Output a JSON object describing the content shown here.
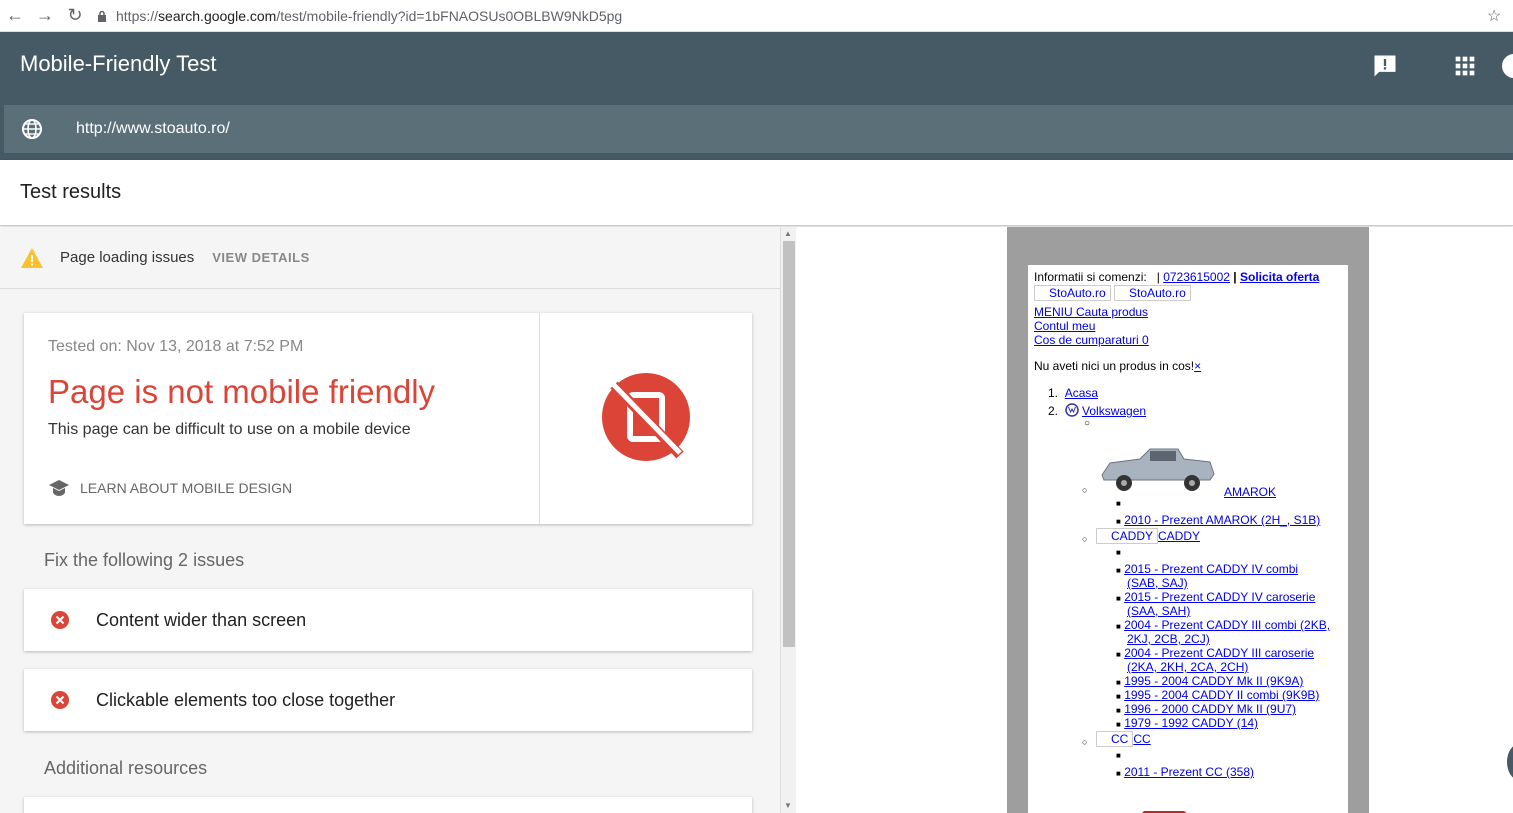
{
  "browser": {
    "url_prefix": "https://",
    "url_host": "search.google.com",
    "url_path": "/test/mobile-friendly?id=1bFNAOSUs0OBLBW9NkD5pg"
  },
  "app": {
    "title": "Mobile-Friendly Test",
    "tested_url": "http://www.stoauto.ro/"
  },
  "results": {
    "heading": "Test results",
    "loading_issues_label": "Page loading issues",
    "view_details_label": "VIEW DETAILS",
    "tested_on": "Tested on: Nov 13, 2018 at 7:52 PM",
    "verdict": "Page is not mobile friendly",
    "verdict_sub": "This page can be difficult to use on a mobile device",
    "learn_label": "LEARN ABOUT MOBILE DESIGN",
    "fix_heading": "Fix the following 2 issues",
    "issues": [
      {
        "label": "Content wider than screen"
      },
      {
        "label": "Clickable elements too close together"
      }
    ],
    "additional_heading": "Additional resources"
  },
  "colors": {
    "appbar": "#455a64",
    "error_red": "#db4437",
    "warning": "#fbc02d"
  },
  "preview": {
    "info_label": "Informatii si comenzi:",
    "sep": "|",
    "phone": "0723615002",
    "sep2": "|",
    "offer": "Solicita oferta",
    "logo1": "StoAuto.ro",
    "logo2": "StoAuto.ro",
    "menu": "MENIU Cauta produs",
    "account": "Contul meu",
    "cart": "Cos de cumparaturi 0",
    "empty_cart": "Nu aveti nici un produs in cos!",
    "close_x": "×",
    "crumb1_num": "1.",
    "crumb1": "Acasa",
    "crumb2_num": "2.",
    "crumb2": "Volkswagen",
    "amarok": "AMAROK",
    "amarok_items": [
      "2010 - Prezent AMAROK (2H_, S1B)"
    ],
    "caddy_box": "CADDY",
    "caddy": "CADDY",
    "caddy_items": [
      "2015 - Prezent CADDY IV combi",
      "(SAB, SAJ)",
      "2015 - Prezent CADDY IV caroserie",
      "(SAA, SAH)",
      "2004 - Prezent CADDY III combi (2KB,",
      "2KJ, 2CB, 2CJ)",
      "2004 - Prezent CADDY III caroserie",
      "(2KA, 2KH, 2CA, 2CH)",
      "1995 - 2004 CADDY Mk II (9K9A)",
      "1995 - 2004 CADDY II combi (9K9B)",
      "1996 - 2000 CADDY Mk II (9U7)",
      "1979 - 1992 CADDY   (14)"
    ],
    "cc_box": "CC",
    "cc": "CC",
    "cc_items": [
      "2011 - Prezent CC (358)"
    ]
  }
}
